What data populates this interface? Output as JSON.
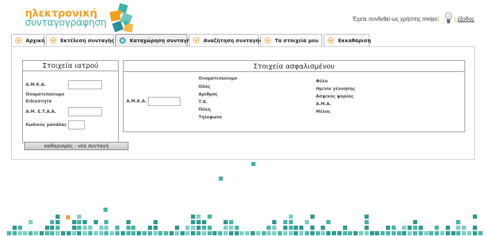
{
  "logo": {
    "line1": "ηλεκτρονική",
    "line2": "συνταγογράφηση"
  },
  "header": {
    "login_text": "Έχετε συνδεθεί ως χρήστης melpo",
    "logout_label": "έξοδος"
  },
  "tabs": [
    {
      "label": "Αρχική",
      "active": false
    },
    {
      "label": "Εκτέλεση συνταγής",
      "active": false
    },
    {
      "label": "Καταχώρηση συνταγής",
      "active": true
    },
    {
      "label": "Αναζήτηση συνταγής",
      "active": false
    },
    {
      "label": "Τα στοιχεία μου",
      "active": false
    },
    {
      "label": "Εκκαθάριση",
      "active": false
    }
  ],
  "doctor": {
    "title": "Στοιχεία ιατρού",
    "amka_label": "Α.Μ.Κ.Α.",
    "name_label": "Ονοματεπώνυμο",
    "specialty_label": "Ειδικότητα",
    "ameta_label": "Α.Μ. Ε.Τ.Α.Α.",
    "unit_code_label": "Κωδικός μονάδας",
    "amka_value": "",
    "ameta_value": "",
    "unit_code_value": ""
  },
  "insured": {
    "title": "Στοιχεία ασφαλισμένου",
    "amka_label": "Α.Μ.Κ.Α.",
    "amka_value": "",
    "col1": [
      "Ονοματεπώνυμο",
      "Οδός",
      "Αριθμός",
      "Τ.Κ.",
      "Πόλη",
      "Τηλέφωνο"
    ],
    "col2": [
      "Φύλο",
      "Ημ/νία γέννησης",
      "Ασφ/κός φορέας",
      "Α.Μ.Α.",
      "Μέλος"
    ]
  },
  "reset_label": "καθαρισμός - νέα συνταγή",
  "colors": {
    "accent_orange": "#f0a020",
    "accent_teal": "#3bb3a8"
  }
}
